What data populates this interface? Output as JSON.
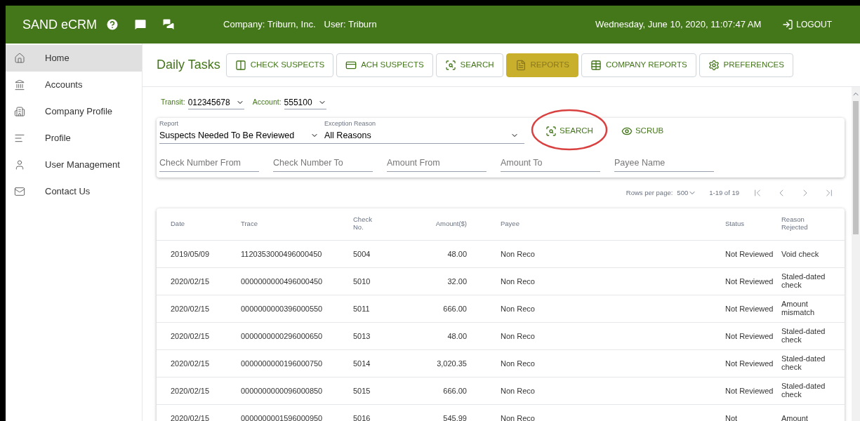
{
  "header": {
    "app_name": "SAND eCRM",
    "company": "Company: Triburn, Inc.",
    "user": "User: Triburn",
    "datetime": "Wednesday, June 10, 2020, 11:07:47 AM",
    "logout": "LOGOUT"
  },
  "sidebar": {
    "items": [
      {
        "label": "Home",
        "selected": true
      },
      {
        "label": "Accounts",
        "selected": false
      },
      {
        "label": "Company Profile",
        "selected": false
      },
      {
        "label": "Profile",
        "selected": false
      },
      {
        "label": "User Management",
        "selected": false
      },
      {
        "label": "Contact Us",
        "selected": false
      }
    ]
  },
  "tabs_title": "Daily Tasks",
  "tabs": [
    {
      "label": "CHECK SUSPECTS",
      "selected": false
    },
    {
      "label": "ACH SUSPECTS",
      "selected": false
    },
    {
      "label": "SEARCH",
      "selected": false
    },
    {
      "label": "REPORTS",
      "selected": true
    },
    {
      "label": "COMPANY REPORTS",
      "selected": false
    },
    {
      "label": "PREFERENCES",
      "selected": false
    }
  ],
  "account_select": {
    "transit_label": "Transit:",
    "transit": "012345678",
    "account_label": "Account:",
    "account": "555100"
  },
  "filters": {
    "report": {
      "label": "Report",
      "value": "Suspects Needed To Be Reviewed"
    },
    "exception_reason": {
      "label": "Exception Reason",
      "value": "All Reasons"
    },
    "search_button": "SEARCH",
    "scrub_button": "SCRUB",
    "fields": [
      {
        "placeholder": "Check Number From"
      },
      {
        "placeholder": "Check Number To"
      },
      {
        "placeholder": "Amount From"
      },
      {
        "placeholder": "Amount To"
      },
      {
        "placeholder": "Payee Name"
      }
    ]
  },
  "pagination": {
    "rows_per_page_label": "Rows per page:",
    "rows_per_page": "500",
    "range": "1-19 of 19"
  },
  "table": {
    "columns": [
      "Date",
      "Trace",
      "Check No.",
      "Amount($)",
      "Payee",
      "Status",
      "Reason Rejected"
    ],
    "rows": [
      [
        "2019/05/09",
        "1120353000496000450",
        "5004",
        "48.00",
        "Non Reco",
        "Not Reviewed",
        "Void check"
      ],
      [
        "2020/02/15",
        "0000000000496000450",
        "5010",
        "32.00",
        "Non Reco",
        "Not Reviewed",
        "Staled-dated check"
      ],
      [
        "2020/02/15",
        "0000000000396000550",
        "5011",
        "666.00",
        "Non Reco",
        "Not Reviewed",
        "Amount mismatch"
      ],
      [
        "2020/02/15",
        "0000000000296000650",
        "5013",
        "48.00",
        "Non Reco",
        "Not Reviewed",
        "Staled-dated check"
      ],
      [
        "2020/02/15",
        "0000000000196000750",
        "5014",
        "3,020.35",
        "Non Reco",
        "Not Reviewed",
        "Staled-dated check"
      ],
      [
        "2020/02/15",
        "0000000000096000850",
        "5015",
        "666.00",
        "Non Reco",
        "Not Reviewed",
        "Staled-dated check"
      ],
      [
        "2020/02/15",
        "0000000001596000950",
        "5016",
        "545.99",
        "Non Reco",
        "Not",
        "Amount"
      ]
    ]
  }
}
